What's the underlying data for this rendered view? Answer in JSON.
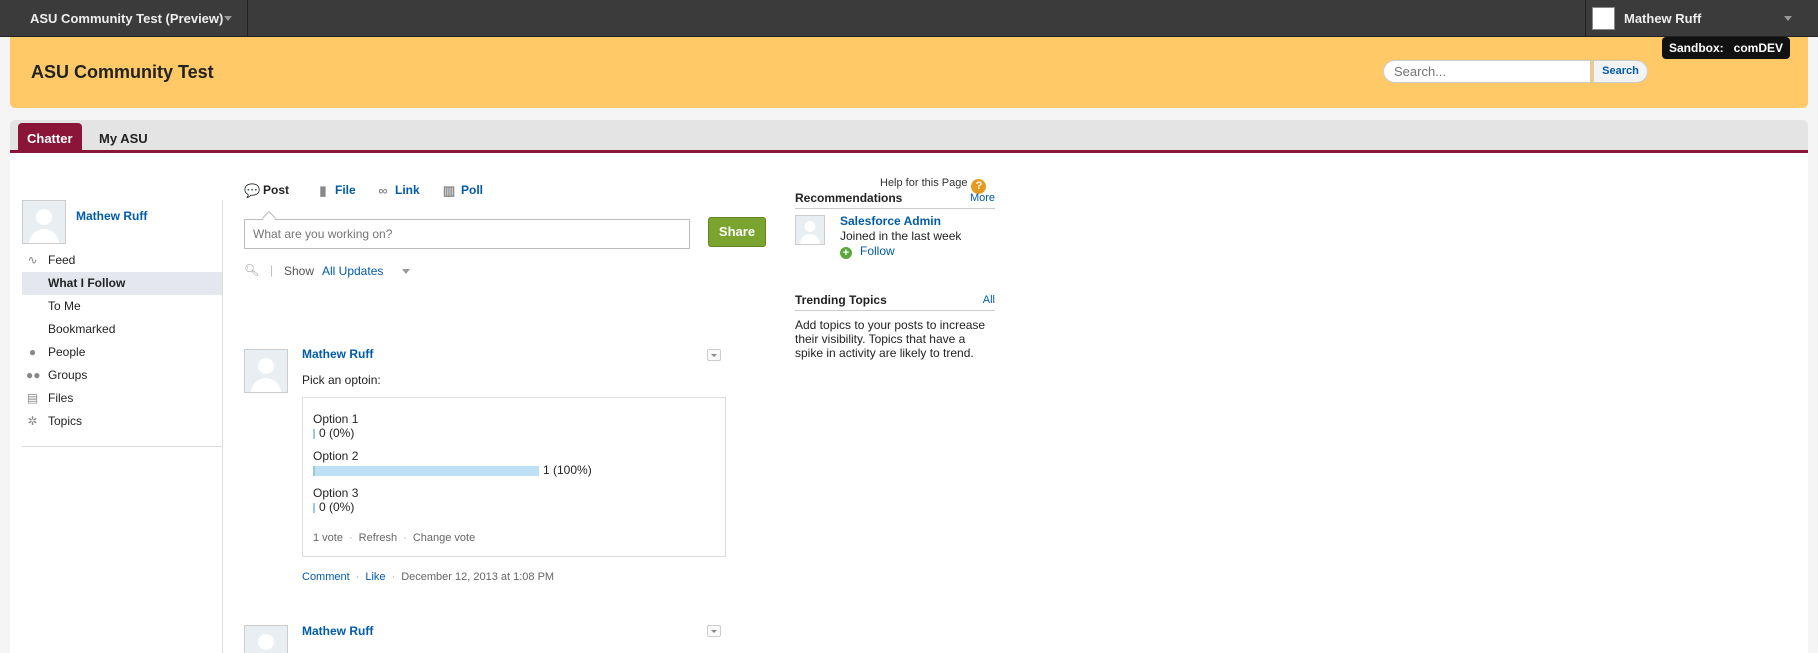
{
  "topbar": {
    "community_name": "ASU Community Test (Preview)",
    "user_name": "Mathew Ruff",
    "sandbox_label": "Sandbox:",
    "sandbox_value": "comDEV"
  },
  "header": {
    "title": "ASU Community Test",
    "search_placeholder": "Search...",
    "search_button": "Search",
    "background": "#fec966"
  },
  "tabs": [
    {
      "label": "Chatter",
      "active": true
    },
    {
      "label": "My ASU",
      "active": false
    }
  ],
  "colors": {
    "accent": "#8a1538",
    "link": "#015ba7",
    "share": "#7aa42e"
  },
  "help": {
    "label": "Help for this Page",
    "icon": "question-icon"
  },
  "profile": {
    "name": "Mathew Ruff"
  },
  "sidebar": {
    "items": [
      {
        "label": "Feed",
        "icon": "pulse-icon"
      },
      {
        "label": "What I Follow",
        "selected": true
      },
      {
        "label": "To Me"
      },
      {
        "label": "Bookmarked"
      },
      {
        "label": "People",
        "icon": "person-icon"
      },
      {
        "label": "Groups",
        "icon": "group-icon"
      },
      {
        "label": "Files",
        "icon": "file-icon"
      },
      {
        "label": "Topics",
        "icon": "topic-icon"
      }
    ]
  },
  "publisher": {
    "tabs": [
      {
        "label": "Post",
        "icon": "speech-bubble-icon"
      },
      {
        "label": "File",
        "icon": "file-icon"
      },
      {
        "label": "Link",
        "icon": "link-icon"
      },
      {
        "label": "Poll",
        "icon": "bar-chart-icon"
      }
    ],
    "placeholder": "What are you working on?",
    "share_label": "Share"
  },
  "filter": {
    "show_label": "Show",
    "selected": "All Updates"
  },
  "feed": [
    {
      "author": "Mathew Ruff",
      "text": "Pick an optoin:",
      "poll": {
        "options": [
          {
            "label": "Option 1",
            "count": "0 (0%)",
            "fraction": 0
          },
          {
            "label": "Option 2",
            "count": "1 (100%)",
            "fraction": 1
          },
          {
            "label": "Option 3",
            "count": "0 (0%)",
            "fraction": 0
          }
        ],
        "votes": "1 vote",
        "refresh": "Refresh",
        "change_vote": "Change vote"
      },
      "actions": {
        "comment": "Comment",
        "like": "Like",
        "timestamp": "December 12, 2013 at 1:08 PM"
      }
    },
    {
      "author": "Mathew Ruff"
    }
  ],
  "recommendations": {
    "title": "Recommendations",
    "more": "More",
    "item": {
      "name": "Salesforce Admin",
      "subtitle": "Joined in the last week",
      "follow": "Follow"
    }
  },
  "trending": {
    "title": "Trending Topics",
    "all": "All",
    "description": "Add topics to your posts to increase their visibility. Topics that have a spike in activity are likely to trend."
  }
}
